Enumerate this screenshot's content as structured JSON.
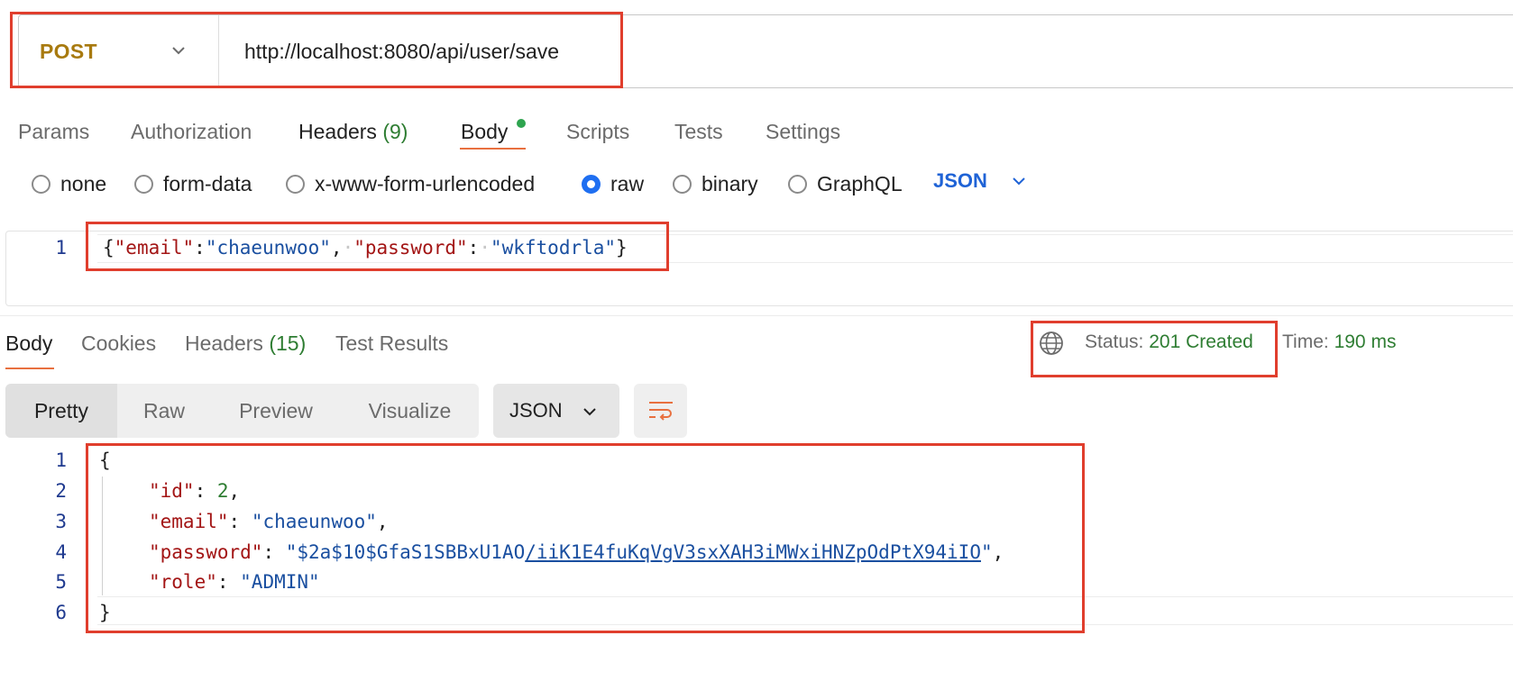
{
  "request": {
    "method": "POST",
    "url": "http://localhost:8080/api/user/save"
  },
  "request_tabs": [
    {
      "label": "Params"
    },
    {
      "label": "Authorization"
    },
    {
      "label": "Headers",
      "count": "(9)"
    },
    {
      "label": "Body",
      "active": true
    },
    {
      "label": "Scripts"
    },
    {
      "label": "Tests"
    },
    {
      "label": "Settings"
    }
  ],
  "body_types": {
    "options": [
      "none",
      "form-data",
      "x-www-form-urlencoded",
      "raw",
      "binary",
      "GraphQL"
    ],
    "selected": "raw",
    "language": "JSON"
  },
  "request_body": {
    "line_numbers": [
      "1"
    ],
    "tokens": {
      "open": "{",
      "key_email": "\"email\"",
      "colon": ":",
      "val_email": "\"chaeunwoo\"",
      "comma": ",",
      "space_dot": "·",
      "key_password": "\"password\"",
      "val_password": "\"wkftodrla\"",
      "close": "}"
    }
  },
  "response_tabs": [
    {
      "label": "Body",
      "active": true
    },
    {
      "label": "Cookies"
    },
    {
      "label": "Headers",
      "count": "(15)"
    },
    {
      "label": "Test Results"
    }
  ],
  "response_meta": {
    "status_label": "Status:",
    "status_value": "201 Created",
    "time_label": "Time:",
    "time_value": "190 ms"
  },
  "response_view": {
    "modes": [
      "Pretty",
      "Raw",
      "Preview",
      "Visualize"
    ],
    "active_mode": "Pretty",
    "format": "JSON"
  },
  "response_body": {
    "line_numbers": [
      "1",
      "2",
      "3",
      "4",
      "5",
      "6"
    ],
    "open": "{",
    "close": "}",
    "id_key": "\"id\"",
    "id_value": "2",
    "email_key": "\"email\"",
    "email_value": "\"chaeunwoo\"",
    "password_key": "\"password\"",
    "password_value_a": "\"$2a$10$GfaS1SBBxU1AO",
    "password_value_b": "/iiK1E4fuKqVgV3sxXAH3iMWxiHNZpOdPtX94iIO",
    "password_value_c": "\"",
    "role_key": "\"role\"",
    "role_value": "\"ADMIN\"",
    "colon_space": ": ",
    "comma": ","
  },
  "icons": {
    "method_dropdown": "chevron-down-icon",
    "language_dropdown": "chevron-down-icon",
    "network": "globe-icon",
    "format_dropdown": "chevron-down-icon",
    "wrap": "wrap-lines-icon"
  },
  "colors": {
    "method": "#a87a0f",
    "highlight": "#e03e2d",
    "accent": "#e8703f",
    "success": "#2e7d32",
    "radio_selected": "#1f6ff1",
    "json_key": "#a31515",
    "json_string": "#1a4fa0"
  }
}
